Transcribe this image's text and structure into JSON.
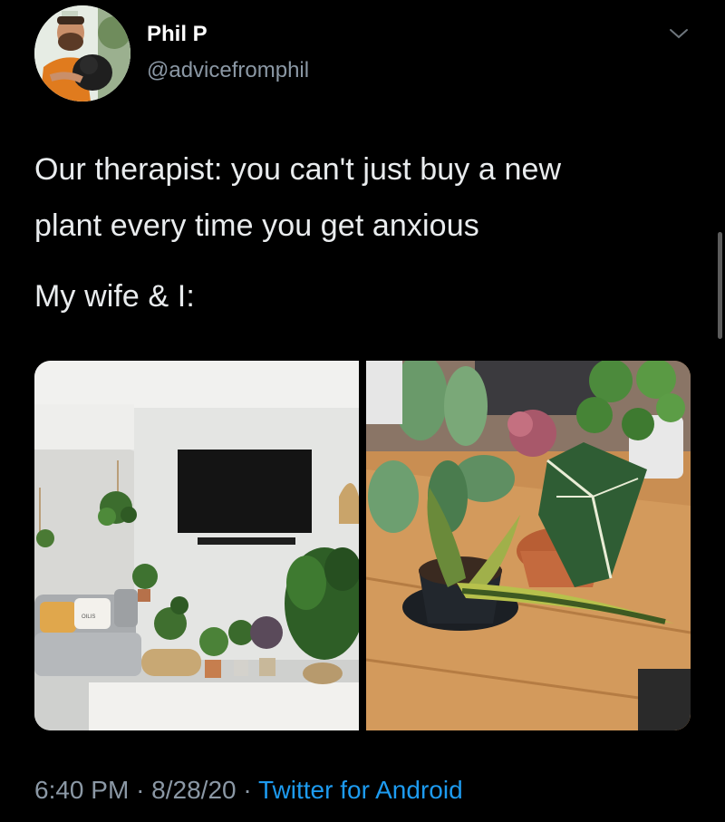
{
  "author": {
    "display_name": "Phil P",
    "handle": "@advicefromphil",
    "avatar_icon": "profile-photo"
  },
  "tweet": {
    "lines": [
      "Our therapist: you can't just buy a new",
      "plant every time you get anxious",
      "My wife & I:"
    ]
  },
  "media": {
    "images": [
      {
        "icon": "living-room-plants-photo"
      },
      {
        "icon": "potted-plants-table-photo"
      }
    ]
  },
  "meta": {
    "time": "6:40 PM",
    "separator": "·",
    "date": "8/28/20",
    "source": "Twitter for Android"
  },
  "colors": {
    "background": "#000000",
    "text": "#e9ecee",
    "secondary": "#8b98a5",
    "link": "#1d9bf0"
  },
  "pillow_text": "OILIS"
}
